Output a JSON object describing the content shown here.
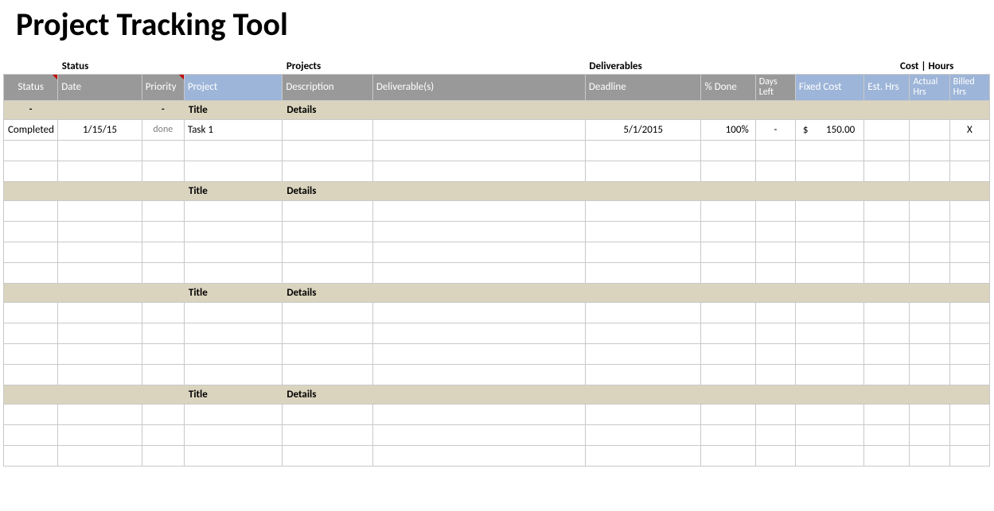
{
  "page_title": "Project Tracking Tool",
  "sections": {
    "status": "Status",
    "projects": "Projects",
    "deliverables": "Deliverables",
    "cost_hours": "Cost | Hours"
  },
  "headers": {
    "status": "Status",
    "date": "Date",
    "priority": "Priority",
    "project": "Project",
    "description": "Description",
    "deliverable": "Deliverable(s)",
    "deadline": "Deadline",
    "pct_done": "% Done",
    "days_left": "Days Left",
    "fixed_cost": "Fixed Cost",
    "est_hrs": "Est. Hrs",
    "actual_hrs": "Actual Hrs",
    "billed_hrs": "Billed Hrs"
  },
  "group_labels": {
    "title": "Title",
    "details": "Details"
  },
  "placeholder_dash": "-",
  "rows": [
    {
      "status": "Completed",
      "date": "1/15/15",
      "priority": "done",
      "project": "Task 1",
      "description": "",
      "deliverable": "",
      "deadline": "5/1/2015",
      "pct_done": "100%",
      "days_left": "-",
      "fixed_cost_sym": "$",
      "fixed_cost_val": "150.00",
      "est_hrs": "",
      "actual_hrs": "",
      "billed_hrs": "X"
    }
  ]
}
